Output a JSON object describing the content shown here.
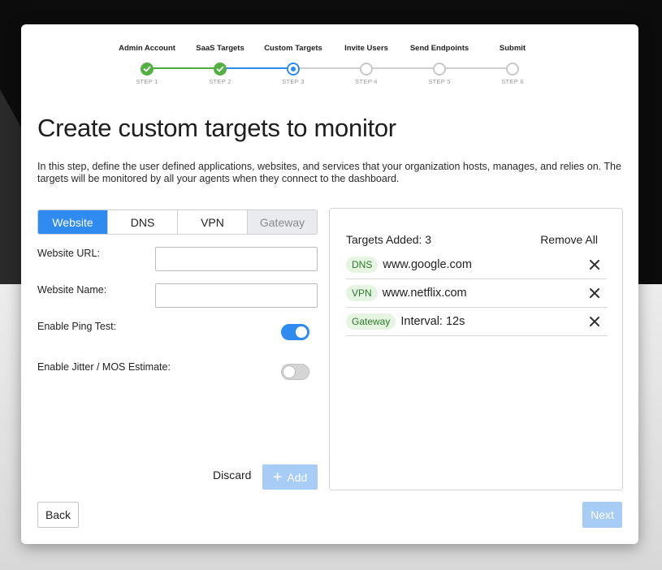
{
  "stepper": {
    "steps": [
      {
        "title": "Admin Account",
        "sub": "STEP 1",
        "state": "done"
      },
      {
        "title": "SaaS Targets",
        "sub": "STEP 2",
        "state": "done"
      },
      {
        "title": "Custom Targets",
        "sub": "STEP 3",
        "state": "current"
      },
      {
        "title": "Invite Users",
        "sub": "STEP 4",
        "state": "todo"
      },
      {
        "title": "Send Endpoints",
        "sub": "STEP 5",
        "state": "todo"
      },
      {
        "title": "Submit",
        "sub": "STEP 6",
        "state": "todo"
      }
    ]
  },
  "page": {
    "title": "Create custom targets to monitor",
    "description": "In this step, define the user defined applications, websites, and services that your organization hosts, manages, and relies on. The targets will be monitored by all your agents when they connect to the dashboard."
  },
  "tabs": [
    {
      "label": "Website",
      "state": "active"
    },
    {
      "label": "DNS",
      "state": "normal"
    },
    {
      "label": "VPN",
      "state": "normal"
    },
    {
      "label": "Gateway",
      "state": "disabled"
    }
  ],
  "form": {
    "website_url_label": "Website URL:",
    "website_url_value": "",
    "website_name_label": "Website Name:",
    "website_name_value": "",
    "ping_label": "Enable Ping Test:",
    "ping_on": true,
    "jitter_label": "Enable Jitter / MOS Estimate:",
    "jitter_on": false,
    "discard_label": "Discard",
    "add_label": "Add"
  },
  "targets": {
    "count_label": "Targets Added: 3",
    "remove_all_label": "Remove All",
    "items": [
      {
        "type": "DNS",
        "value": "www.google.com"
      },
      {
        "type": "VPN",
        "value": "www.netflix.com"
      },
      {
        "type": "Gateway",
        "value": "Interval: 12s"
      }
    ]
  },
  "footer": {
    "back_label": "Back",
    "next_label": "Next"
  },
  "colors": {
    "primary": "#2f8bf0",
    "success": "#52b043",
    "disabled_primary": "#a7cdf7"
  }
}
